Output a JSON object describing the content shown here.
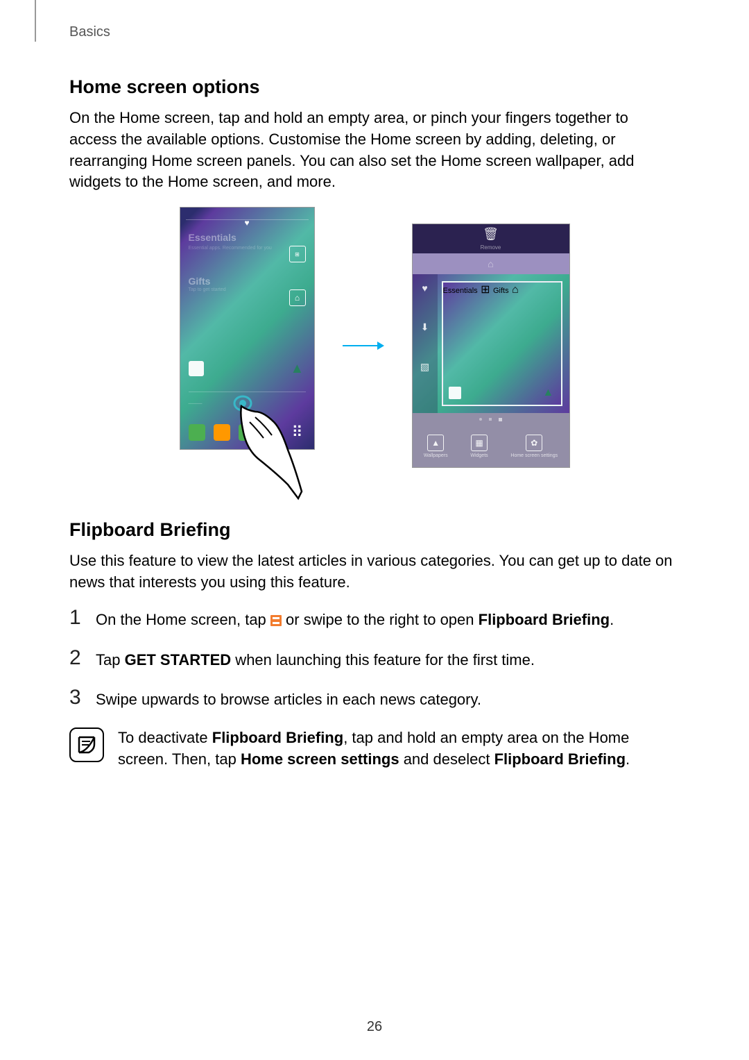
{
  "breadcrumb": "Basics",
  "heading1": "Home screen options",
  "body1": "On the Home screen, tap and hold an empty area, or pinch your fingers together to access the available options. Customise the Home screen by adding, deleting, or rearranging Home screen panels. You can also set the Home screen wallpaper, add widgets to the Home screen, and more.",
  "figure": {
    "left": {
      "labels": {
        "l1": "Essentials",
        "l2": "Gifts"
      },
      "sublabels": {
        "s1": "Essential apps. Recommended for you",
        "s2": "Tap to get started"
      }
    },
    "right": {
      "trash": "Remove",
      "labels": {
        "l1": "Essentials",
        "l2": "Gifts"
      },
      "bottom": {
        "b1": "Wallpapers",
        "b2": "Widgets",
        "b3": "Home screen settings"
      }
    }
  },
  "heading2": "Flipboard Briefing",
  "body2": "Use this feature to view the latest articles in various categories. You can get up to date on news that interests you using this feature.",
  "steps": {
    "s1": {
      "num": "1",
      "pre": "On the Home screen, tap ",
      "post": " or swipe to the right to open ",
      "bold": "Flipboard Briefing",
      "end": "."
    },
    "s2": {
      "num": "2",
      "pre": "Tap ",
      "bold": "GET STARTED",
      "post": " when launching this feature for the first time."
    },
    "s3": {
      "num": "3",
      "text": "Swipe upwards to browse articles in each news category."
    }
  },
  "note": {
    "pre": "To deactivate ",
    "b1": "Flipboard Briefing",
    "mid": ", tap and hold an empty area on the Home screen. Then, tap ",
    "b2": "Home screen settings",
    "mid2": " and deselect ",
    "b3": "Flipboard Briefing",
    "end": "."
  },
  "pageNumber": "26"
}
